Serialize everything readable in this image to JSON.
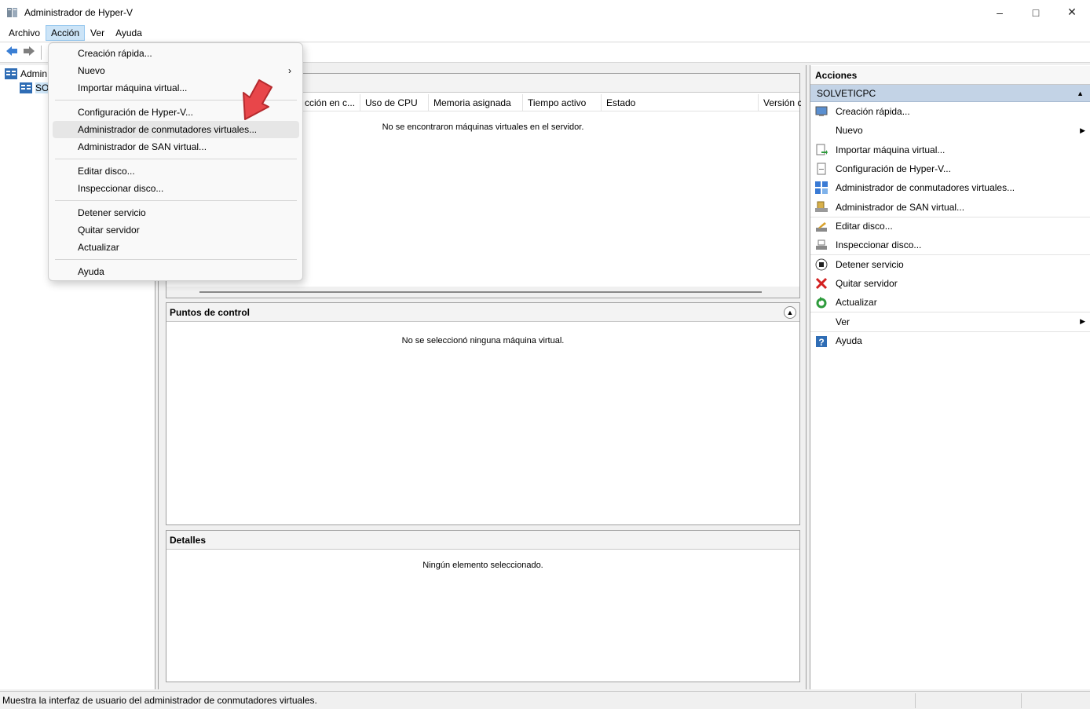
{
  "window": {
    "title": "Administrador de Hyper-V"
  },
  "menubar": [
    "Archivo",
    "Acción",
    "Ver",
    "Ayuda"
  ],
  "tree": {
    "root": "Admin",
    "server": "SO"
  },
  "vm_panel": {
    "columns": [
      "cción en c...",
      "Uso de CPU",
      "Memoria asignada",
      "Tiempo activo",
      "Estado",
      "Versión c"
    ],
    "empty": "No se encontraron máquinas virtuales en el servidor."
  },
  "checkpoints_panel": {
    "title": "Puntos de control",
    "empty": "No se seleccionó ninguna máquina virtual."
  },
  "details_panel": {
    "title": "Detalles",
    "empty": "Ningún elemento seleccionado."
  },
  "actions": {
    "title": "Acciones",
    "section": "SOLVETICPC",
    "items": [
      "Creación rápida...",
      "Nuevo",
      "Importar máquina virtual...",
      "Configuración de Hyper-V...",
      "Administrador de conmutadores virtuales...",
      "Administrador de SAN virtual...",
      "Editar disco...",
      "Inspeccionar disco...",
      "Detener servicio",
      "Quitar servidor",
      "Actualizar",
      "Ver",
      "Ayuda"
    ]
  },
  "dropdown": {
    "items": [
      "Creación rápida...",
      "Nuevo",
      "Importar máquina virtual...",
      "Configuración de Hyper-V...",
      "Administrador de conmutadores virtuales...",
      "Administrador de SAN virtual...",
      "Editar disco...",
      "Inspeccionar disco...",
      "Detener servicio",
      "Quitar servidor",
      "Actualizar",
      "Ayuda"
    ]
  },
  "status": "Muestra la interfaz de usuario del administrador de conmutadores virtuales.",
  "colors": {
    "accent": "#cce4f7",
    "section": "#c3d3e6",
    "arrow": "#e8464a"
  }
}
